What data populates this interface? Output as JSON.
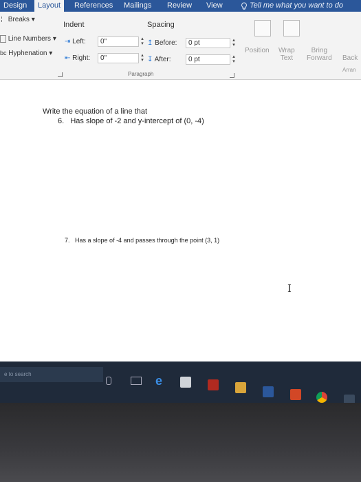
{
  "ribbon_tabs": [
    "Design",
    "Layout",
    "References",
    "Mailings",
    "Review",
    "View"
  ],
  "tell_me": "Tell me what you want to do",
  "page_setup": {
    "breaks": "Breaks",
    "line_numbers": "Line Numbers",
    "hyphenation": "Hyphenation"
  },
  "indent": {
    "heading": "Indent",
    "left_label": "Left:",
    "left_value": "0\"",
    "right_label": "Right:",
    "right_value": "0\""
  },
  "spacing": {
    "heading": "Spacing",
    "before_label": "Before:",
    "before_value": "0 pt",
    "after_label": "After:",
    "after_value": "0 pt"
  },
  "paragraph_group": "Paragraph",
  "arrange": {
    "position": "Position",
    "wrap_text": [
      "Wrap",
      "Text"
    ],
    "bring_forward": [
      "Bring",
      "Forward"
    ],
    "send_backward": "Back",
    "group_label": "Arran"
  },
  "document": {
    "intro": "Write the equation of a line that",
    "q6_num": "6.",
    "q6_text": "Has slope of -2 and y-intercept of (0, -4)",
    "q7_num": "7.",
    "q7_text": "Has a slope of -4 and passes through the point (3, 1)"
  },
  "taskbar": {
    "search_placeholder": "e to search"
  },
  "colors": {
    "word_blue": "#2b579a",
    "taskbar": "#1f2a3a"
  }
}
